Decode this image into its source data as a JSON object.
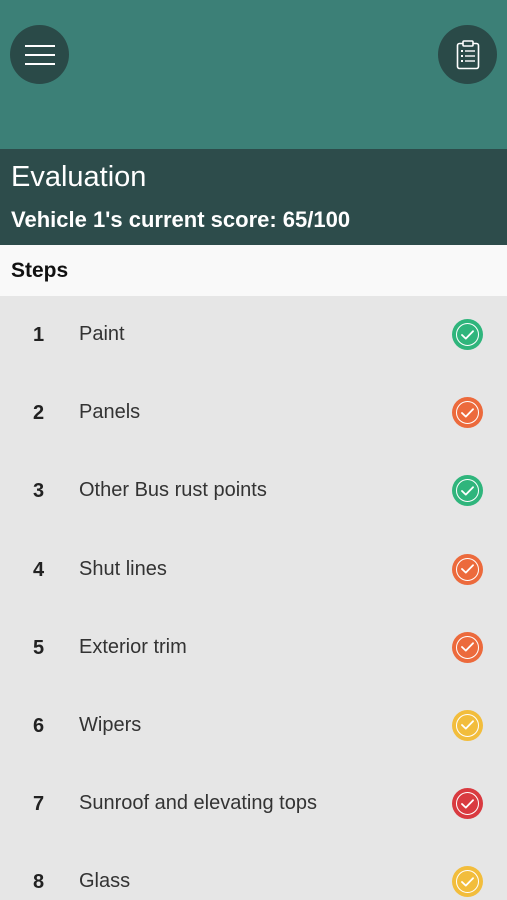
{
  "header": {
    "title": "Evaluation",
    "score_text": "Vehicle 1's current score: 65/100"
  },
  "toolbar": {
    "menu_icon": "hamburger-menu-icon",
    "clipboard_icon": "clipboard-icon"
  },
  "steps_title": "Steps",
  "colors": {
    "topbar": "#3c8077",
    "header": "#2d4c4b",
    "green": "#2fb57c",
    "orange": "#ec6a3c",
    "yellow": "#f2bd3c",
    "red": "#d93a40"
  },
  "steps": [
    {
      "num": "1",
      "label": "Paint",
      "status": "green"
    },
    {
      "num": "2",
      "label": "Panels",
      "status": "orange"
    },
    {
      "num": "3",
      "label": "Other Bus rust points",
      "status": "green"
    },
    {
      "num": "4",
      "label": "Shut lines",
      "status": "orange"
    },
    {
      "num": "5",
      "label": "Exterior trim",
      "status": "orange"
    },
    {
      "num": "6",
      "label": "Wipers",
      "status": "yellow"
    },
    {
      "num": "7",
      "label": "Sunroof and elevating tops",
      "status": "red"
    },
    {
      "num": "8",
      "label": "Glass",
      "status": "yellow"
    }
  ]
}
